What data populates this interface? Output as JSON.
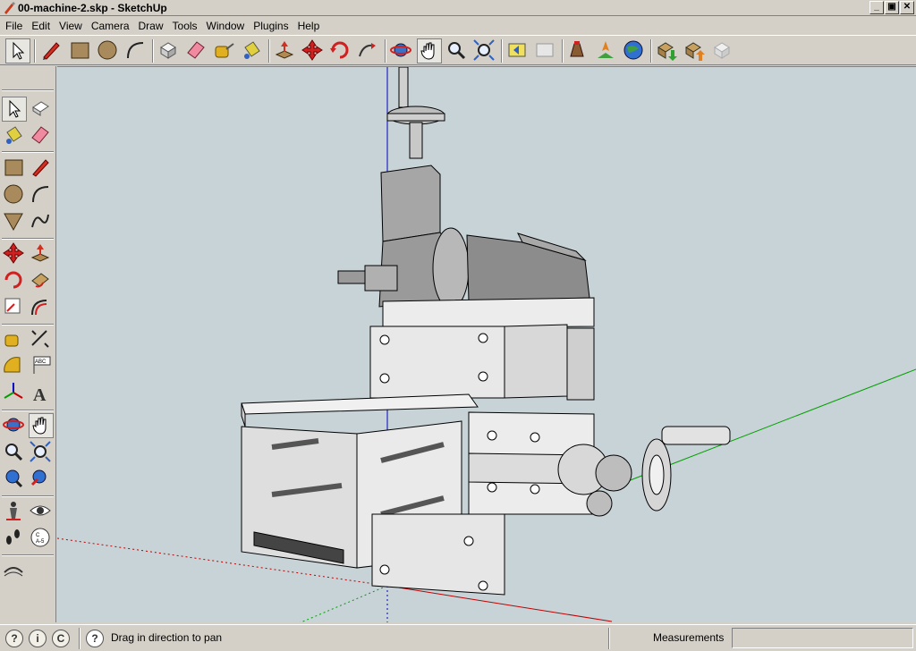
{
  "window": {
    "title": "00-machine-2.skp - SketchUp",
    "min_label": "_",
    "max_label": "▣",
    "close_label": "✕"
  },
  "menu": {
    "items": [
      "File",
      "Edit",
      "View",
      "Camera",
      "Draw",
      "Tools",
      "Window",
      "Plugins",
      "Help"
    ]
  },
  "status": {
    "icons": [
      "?",
      "i",
      "C"
    ],
    "help_icon": "?",
    "message": "Drag in direction to pan",
    "measurements_label": "Measurements",
    "measurements_value": ""
  },
  "colors": {
    "viewport_bg": "#c8d3d7",
    "axis_red": "#c00000",
    "axis_green": "#00a000",
    "axis_blue": "#0000c0",
    "model_face": "#e8e8e8",
    "model_shade": "#a8a8a8"
  },
  "toolbar_icons": [
    "select-icon",
    "pencil-icon",
    "rectangle-icon",
    "circle-icon",
    "arc-icon",
    "make-component-icon",
    "eraser-icon",
    "tape-measure-icon",
    "paint-bucket-icon",
    "push-pull-icon",
    "move-icon",
    "rotate-icon",
    "follow-me-icon",
    "orbit-icon",
    "pan-icon",
    "zoom-icon",
    "zoom-extents-icon",
    "previous-view-icon",
    "next-view-icon",
    "add-location-icon",
    "toggle-terrain-icon",
    "google-earth-icon",
    "get-models-icon",
    "share-model-icon",
    "share-component-icon"
  ]
}
